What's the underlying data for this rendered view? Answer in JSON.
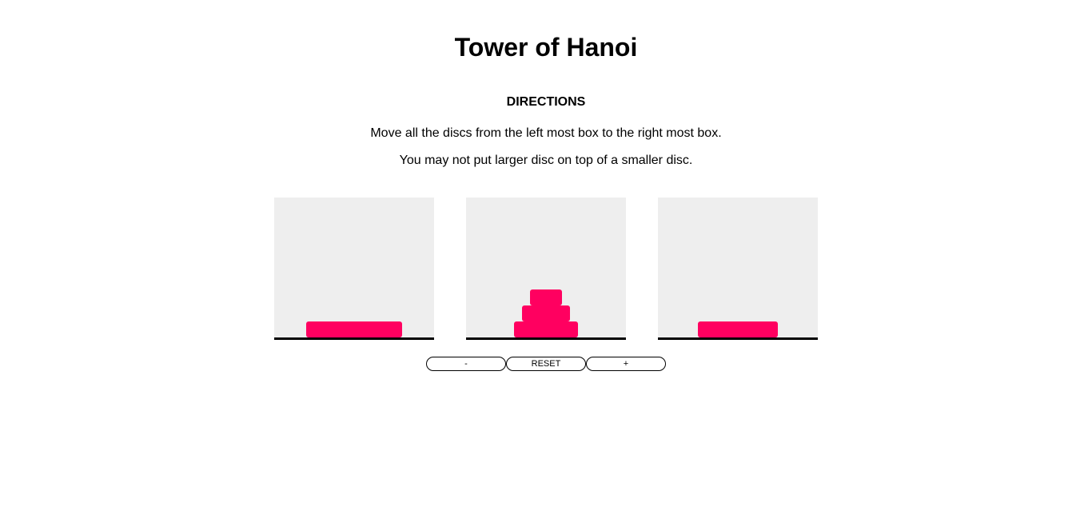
{
  "header": {
    "title": "Tower of Hanoi"
  },
  "directions": {
    "heading": "DIRECTIONS",
    "lines": [
      "Move all the discs from the left most box to the right most box.",
      "You may not put larger disc on top of a smaller disc."
    ]
  },
  "colors": {
    "disc": "#ff0060",
    "tower_background": "#eeeeee",
    "base_line": "#000000"
  },
  "towers": [
    {
      "name": "left",
      "discs": [
        {
          "size": 5
        }
      ]
    },
    {
      "name": "middle",
      "discs": [
        {
          "size": 3
        },
        {
          "size": 2
        },
        {
          "size": 1
        }
      ]
    },
    {
      "name": "right",
      "discs": [
        {
          "size": 4
        }
      ]
    }
  ],
  "controls": {
    "decrease_label": "-",
    "reset_label": "RESET",
    "increase_label": "+"
  }
}
